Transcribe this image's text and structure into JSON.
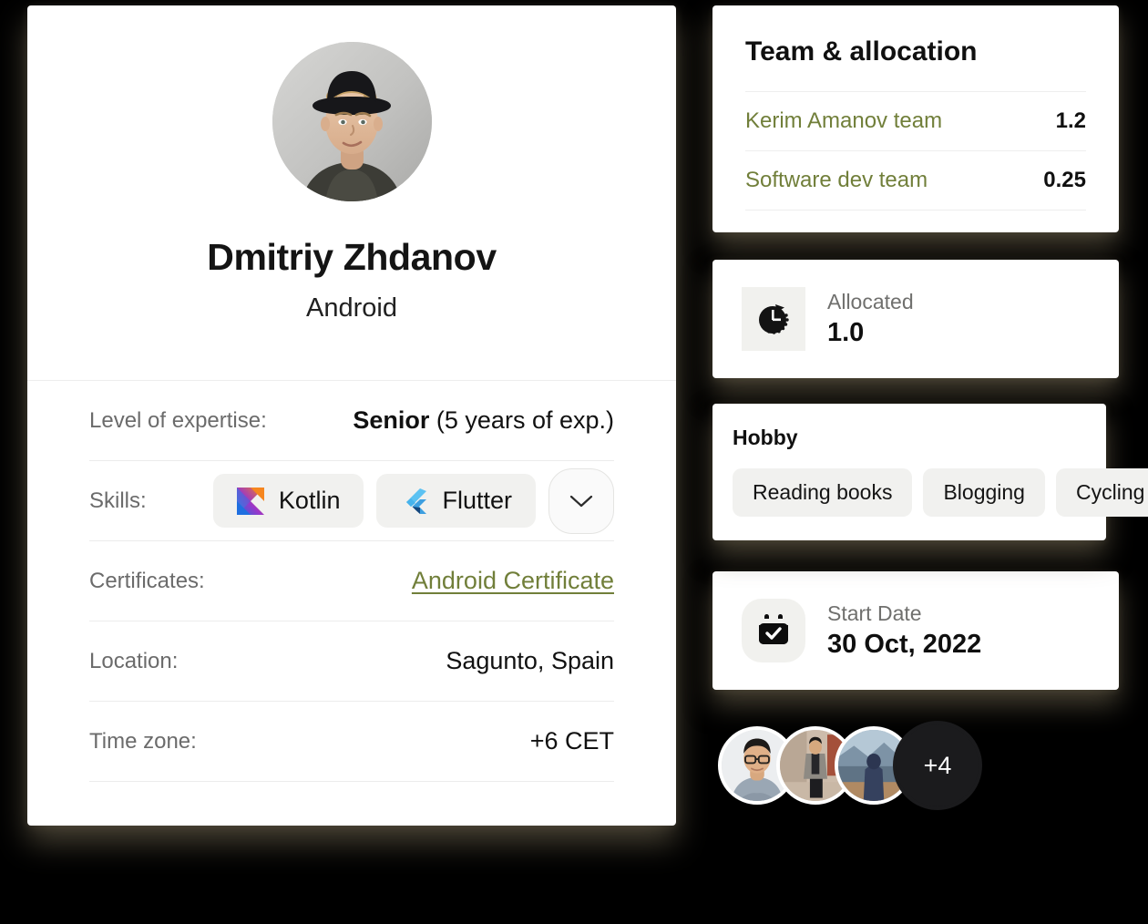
{
  "profile": {
    "avatar_alt": "portrait-photo",
    "name": "Dmitriy Zhdanov",
    "role": "Android",
    "details": [
      {
        "label": "Level of expertise:",
        "value_bold": "Senior",
        "value_rest": " (5 years of exp.)"
      },
      {
        "label": "Skills:"
      },
      {
        "label": "Certificates:",
        "link": "Android Certificate"
      },
      {
        "label": "Location:",
        "value": "Sagunto, Spain"
      },
      {
        "label": "Time zone:",
        "value": "+6 CET"
      }
    ],
    "skills": [
      {
        "name": "Kotlin",
        "icon": "kotlin-icon"
      },
      {
        "name": "Flutter",
        "icon": "flutter-icon"
      }
    ],
    "more_skills_icon": "chevron-down-icon"
  },
  "team": {
    "title": "Team & allocation",
    "rows": [
      {
        "name": "Kerim Amanov team",
        "allocation": "1.2"
      },
      {
        "name": "Software dev team",
        "allocation": "0.25"
      }
    ]
  },
  "allocated": {
    "icon": "clock-icon",
    "label": "Allocated",
    "value": "1.0"
  },
  "hobby": {
    "title": "Hobby",
    "chips": [
      "Reading books",
      "Blogging",
      "Cycling"
    ]
  },
  "start_date": {
    "icon": "calendar-check-icon",
    "label": "Start Date",
    "value": "30 Oct, 2022"
  },
  "members": {
    "avatars": [
      "member-photo-1",
      "member-photo-2",
      "member-photo-3"
    ],
    "overflow_label": "+4"
  },
  "colors": {
    "link_green": "#717f3a",
    "chip_bg": "#f1f1ef",
    "text_dark": "#101010",
    "text_muted": "#6b6b6b",
    "page_bg": "#000000"
  }
}
